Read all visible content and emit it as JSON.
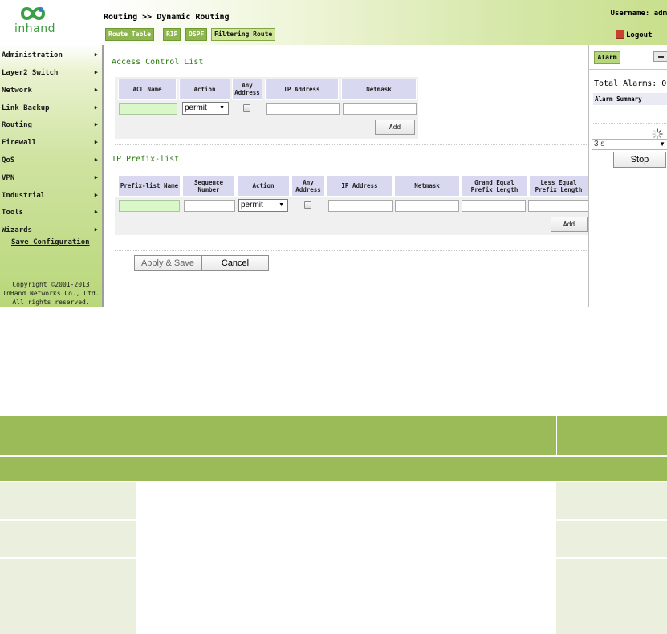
{
  "logo": {
    "text": "inhand"
  },
  "sidebar": {
    "items": [
      {
        "label": "Administration"
      },
      {
        "label": "Layer2 Switch"
      },
      {
        "label": "Network"
      },
      {
        "label": "Link Backup"
      },
      {
        "label": "Routing"
      },
      {
        "label": "Firewall"
      },
      {
        "label": "QoS"
      },
      {
        "label": "VPN"
      },
      {
        "label": "Industrial"
      },
      {
        "label": "Tools"
      },
      {
        "label": "Wizards"
      }
    ],
    "arrow": "▶",
    "save_config": "Save Configuration",
    "copyright": [
      "Copyright ©2001-2013",
      "InHand Networks Co., Ltd.",
      "All rights reserved."
    ]
  },
  "header": {
    "breadcrumb": "Routing >> Dynamic Routing",
    "username": "Username: adm",
    "logout": "Logout",
    "tabs": [
      {
        "label": "Route Table"
      },
      {
        "label": "RIP"
      },
      {
        "label": "OSPF"
      },
      {
        "label": "Filtering Route"
      }
    ]
  },
  "acl": {
    "title": "Access Control List",
    "headers": [
      "ACL Name",
      "Action",
      "Any Address",
      "IP Address",
      "Netmask"
    ],
    "action_value": "permit",
    "add_label": "Add"
  },
  "prefix": {
    "title": "IP Prefix-list",
    "headers": [
      "Prefix-list Name",
      "Sequence Number",
      "Action",
      "Any Address",
      "IP Address",
      "Netmask",
      "Grand Equal Prefix Length",
      "Less Equal Prefix Length"
    ],
    "action_value": "permit",
    "add_label": "Add"
  },
  "actions": {
    "apply_label": "Apply & Save",
    "cancel_label": "Cancel"
  },
  "alarm": {
    "tab_label": "Alarm",
    "total": "Total Alarms: 0",
    "summary": "Alarm Summary",
    "refresh_value": "3 s",
    "stop_label": "Stop"
  },
  "colors": {
    "accent_green": "#8fb550",
    "table_header": "#9bbb59",
    "section_title": "#2e7d10"
  }
}
